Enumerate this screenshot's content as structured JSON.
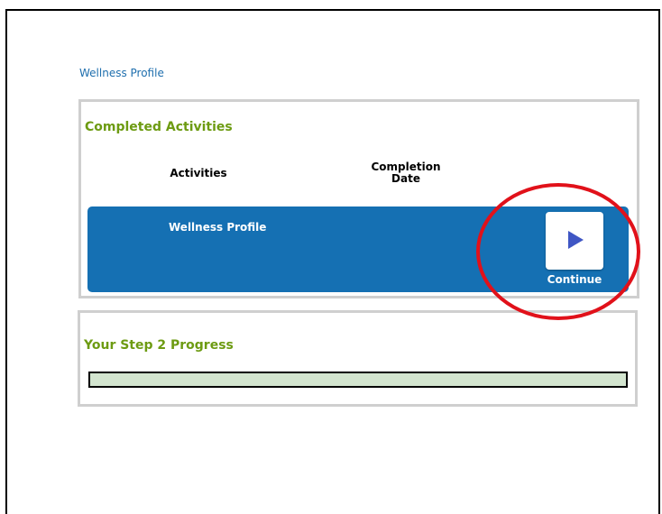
{
  "breadcrumb": {
    "label": "Wellness Profile"
  },
  "completed": {
    "title": "Completed Activities",
    "columns": {
      "activities": "Activities",
      "completion_date": "Completion Date"
    },
    "rows": [
      {
        "activity": "Wellness Profile",
        "completion_date": "",
        "action_label": "Continue",
        "action_icon": "play-icon"
      }
    ]
  },
  "progress": {
    "title": "Your Step 2 Progress",
    "value": 0
  },
  "colors": {
    "title_green": "#6d9b12",
    "row_blue": "#1570b3",
    "link_blue": "#1f6fae",
    "highlight_red": "#e1111a"
  }
}
